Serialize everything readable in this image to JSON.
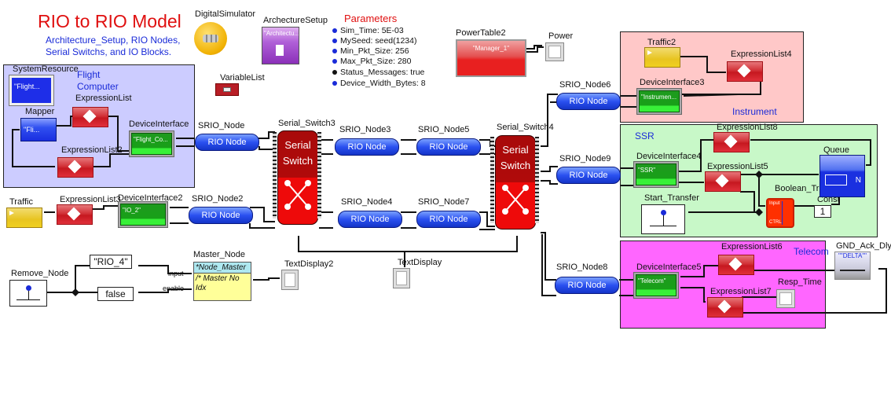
{
  "header": {
    "title": "RIO to RIO Model",
    "subtitle_line1": "Architecture_Setup, RIO Nodes,",
    "subtitle_line2": "Serial Switchs, and IO Blocks."
  },
  "top_blocks": {
    "digital_simulator": "DigitalSimulator",
    "architecture_setup": {
      "label": "ArchectureSetup",
      "value": "\"Architectu..."
    },
    "variable_list": "VariableList",
    "power_table": {
      "label": "PowerTable2",
      "value": "\"Manager_1\""
    },
    "power_scope": "Power"
  },
  "parameters": {
    "title": "Parameters",
    "items": [
      {
        "text": "Sim_Time: 5E-03",
        "bullet": "blue"
      },
      {
        "text": "MySeed: seed(1234)",
        "bullet": "blue"
      },
      {
        "text": "Min_Pkt_Size: 256",
        "bullet": "blue"
      },
      {
        "text": "Max_Pkt_Size: 280",
        "bullet": "blue"
      },
      {
        "text": "Status_Messages: true",
        "bullet": "black"
      },
      {
        "text": "Device_Width_Bytes: 8",
        "bullet": "blue"
      }
    ]
  },
  "flight_computer": {
    "region_label_1": "Flight",
    "region_label_2": "Computer",
    "system_resource": {
      "label": "SystemResource",
      "value": "\"Flight..."
    },
    "mapper": {
      "label": "Mapper",
      "value": "\"Fli..."
    },
    "expression_list": "ExpressionList",
    "expression_list2": "ExpressionList2",
    "device_interface": {
      "label": "DeviceInterface",
      "value": "\"Flight_Co..."
    }
  },
  "io_chain": {
    "traffic": "Traffic",
    "expression_list3": "ExpressionList3",
    "device_interface2": {
      "label": "DeviceInterface2",
      "value": "\"IO_2\""
    }
  },
  "rio_nodes": [
    {
      "label": "SRIO_Node",
      "text": "RIO Node"
    },
    {
      "label": "SRIO_Node2",
      "text": "RIO Node"
    },
    {
      "label": "SRIO_Node3",
      "text": "RIO Node"
    },
    {
      "label": "SRIO_Node5",
      "text": "RIO Node"
    },
    {
      "label": "SRIO_Node4",
      "text": "RIO Node"
    },
    {
      "label": "SRIO_Node7",
      "text": "RIO Node"
    },
    {
      "label": "SRIO_Node6",
      "text": "RIO Node"
    },
    {
      "label": "SRIO_Node9",
      "text": "RIO Node"
    },
    {
      "label": "SRIO_Node8",
      "text": "RIO Node"
    }
  ],
  "switches": [
    {
      "label": "Serial_Switch3",
      "line1": "Serial",
      "line2": "Switch"
    },
    {
      "label": "Serial_Switch4",
      "line1": "Serial",
      "line2": "Switch"
    }
  ],
  "instrument": {
    "region_label": "Instrument",
    "traffic2": "Traffic2",
    "expression_list4": "ExpressionList4",
    "device_interface3": {
      "label": "DeviceInterface3",
      "value": "\"Instrumen..."
    }
  },
  "ssr": {
    "region_label": "SSR",
    "expression_list8": "ExpressionList8",
    "expression_list5": "ExpressionList5",
    "device_interface4": {
      "label": "DeviceInterface4",
      "value": "\"SSR\""
    },
    "start_transfer": "Start_Transfer",
    "boolean_trigger": {
      "label": "Boolean_Trigger",
      "input": "Input",
      "ctrl": "CTRL"
    },
    "const": {
      "label": "Const",
      "value": "1"
    },
    "queue": {
      "label": "Queue",
      "port": "N"
    }
  },
  "telecom": {
    "region_label": "Telecom",
    "expression_list6": "ExpressionList6",
    "expression_list7": "ExpressionList7",
    "device_interface5": {
      "label": "DeviceInterface5",
      "value": "\"Telecom\""
    },
    "resp_time": "Resp_Time",
    "gnd_ack": {
      "label": "GND_Ack_Dly",
      "value": "\"\"DELTA\"\""
    }
  },
  "control": {
    "remove_node": "Remove_Node",
    "rio4_const": "\"RIO_4\"",
    "false_const": "false",
    "master_node": {
      "label": "Master_Node",
      "header": "*Node_Master",
      "body": "/* Master No Idx",
      "input_port": "input",
      "enable_port": "enable"
    },
    "text_display2": "TextDisplay2",
    "text_display": "TextDisplay"
  }
}
